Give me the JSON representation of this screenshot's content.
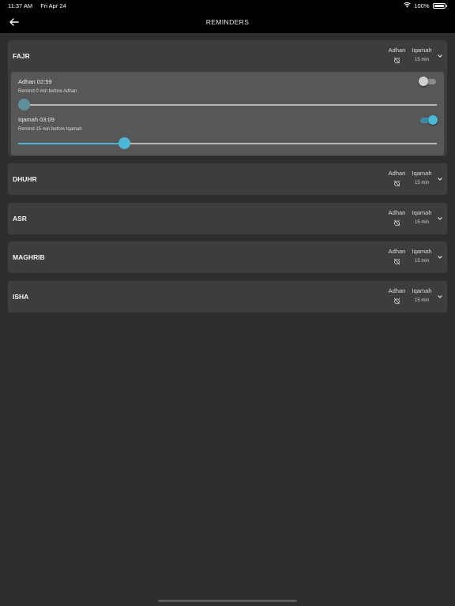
{
  "status": {
    "time": "11:37 AM",
    "date": "Fri Apr 24",
    "battery": "100%"
  },
  "nav": {
    "title": "REMINDERS"
  },
  "labels": {
    "adhan": "Adhan",
    "iqamah": "Iqamah"
  },
  "colors": {
    "accent": "#4cb6d6",
    "inactive_thumb": "#5f8f98",
    "card": "#3d3d3d",
    "panel": "#575757"
  },
  "prayers": [
    {
      "name": "FAJR",
      "iqamah_offset": "15 min",
      "expanded": true
    },
    {
      "name": "DHUHR",
      "iqamah_offset": "15 min",
      "expanded": false
    },
    {
      "name": "ASR",
      "iqamah_offset": "15 min",
      "expanded": false
    },
    {
      "name": "MAGHRIB",
      "iqamah_offset": "15 min",
      "expanded": false
    },
    {
      "name": "ISHA",
      "iqamah_offset": "15 min",
      "expanded": false
    }
  ],
  "fajr_detail": {
    "adhan": {
      "label": "Adhan 02:59",
      "sub": "Remind 0 min before Adhan",
      "enabled": false,
      "minutes": 0
    },
    "iqamah": {
      "label": "Iqamah 03:09",
      "sub": "Remind 15 min before Iqamah",
      "enabled": true,
      "minutes": 15
    },
    "slider_max_minutes": 59
  }
}
